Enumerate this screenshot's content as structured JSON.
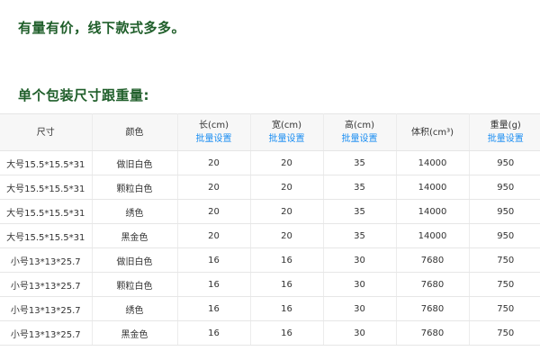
{
  "headline": "有量有价，线下款式多多。",
  "section_title": "单个包装尺寸跟重量:",
  "table": {
    "headers": [
      {
        "label": "尺寸",
        "action": ""
      },
      {
        "label": "颜色",
        "action": ""
      },
      {
        "label": "长(cm)",
        "action": "批量设置"
      },
      {
        "label": "宽(cm)",
        "action": "批量设置"
      },
      {
        "label": "高(cm)",
        "action": "批量设置"
      },
      {
        "label": "体积(cm³)",
        "action": ""
      },
      {
        "label": "重量(g)",
        "action": "批量设置"
      }
    ],
    "rows": [
      [
        "大号15.5*15.5*31",
        "做旧白色",
        "20",
        "20",
        "35",
        "14000",
        "950"
      ],
      [
        "大号15.5*15.5*31",
        "颗粒白色",
        "20",
        "20",
        "35",
        "14000",
        "950"
      ],
      [
        "大号15.5*15.5*31",
        "绣色",
        "20",
        "20",
        "35",
        "14000",
        "950"
      ],
      [
        "大号15.5*15.5*31",
        "黑金色",
        "20",
        "20",
        "35",
        "14000",
        "950"
      ],
      [
        "小号13*13*25.7",
        "做旧白色",
        "16",
        "16",
        "30",
        "7680",
        "750"
      ],
      [
        "小号13*13*25.7",
        "颗粒白色",
        "16",
        "16",
        "30",
        "7680",
        "750"
      ],
      [
        "小号13*13*25.7",
        "绣色",
        "16",
        "16",
        "30",
        "7680",
        "750"
      ],
      [
        "小号13*13*25.7",
        "黑金色",
        "16",
        "16",
        "30",
        "7680",
        "750"
      ]
    ]
  }
}
